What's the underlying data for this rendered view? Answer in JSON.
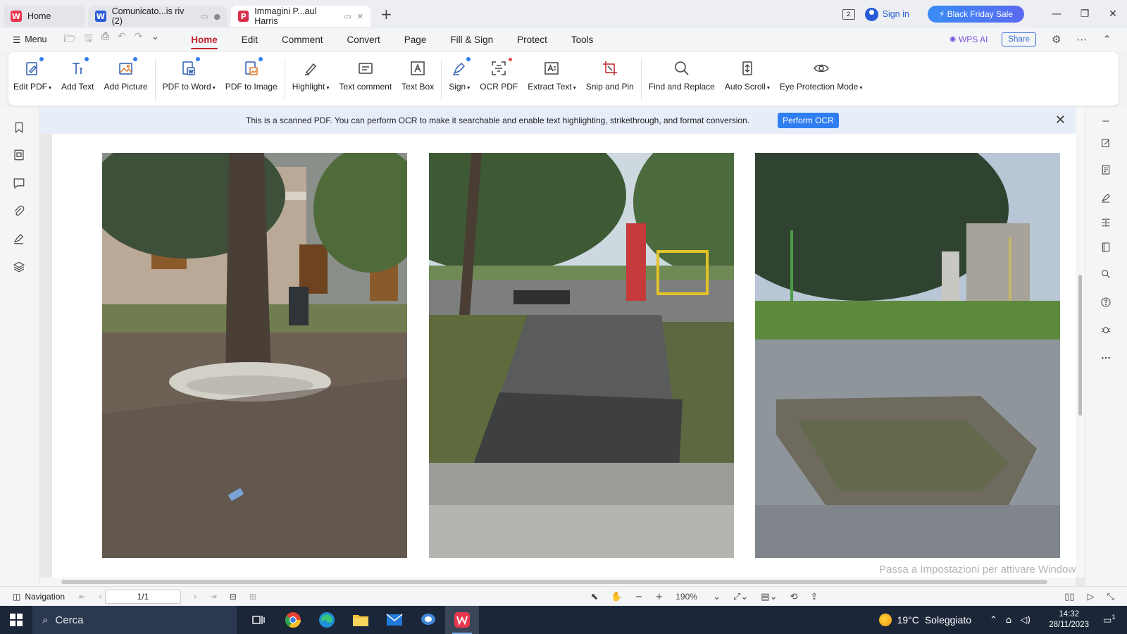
{
  "tabs": [
    {
      "label": "Home",
      "icon": "wps-logo-icon"
    },
    {
      "label": "Comunicato...is riv (2)",
      "icon": "word-doc-icon"
    },
    {
      "label": "Immagini P...aul Harris",
      "icon": "pdf-doc-icon"
    }
  ],
  "titlebar": {
    "page_indicator": "2",
    "sign_in": "Sign in",
    "promo": "Black Friday Sale"
  },
  "menubar": {
    "menu_label": "Menu",
    "tabs": [
      "Home",
      "Edit",
      "Comment",
      "Convert",
      "Page",
      "Fill & Sign",
      "Protect",
      "Tools"
    ],
    "active_tab": "Home",
    "wps_ai": "WPS AI",
    "share": "Share"
  },
  "ribbon": {
    "edit_pdf": "Edit PDF",
    "add_text": "Add Text",
    "add_picture": "Add Picture",
    "pdf_to_word": "PDF to Word",
    "pdf_to_image": "PDF to Image",
    "highlight": "Highlight",
    "text_comment": "Text comment",
    "text_box": "Text Box",
    "sign": "Sign",
    "ocr_pdf": "OCR PDF",
    "extract_text": "Extract Text",
    "snip_and_pin": "Snip and Pin",
    "find_and_replace": "Find and Replace",
    "auto_scroll": "Auto Scroll",
    "eye_protection": "Eye Protection Mode"
  },
  "ocr_banner": {
    "message": "This is a scanned PDF. You can perform OCR to make it searchable and enable text highlighting, strikethrough, and format conversion.",
    "button": "Perform OCR"
  },
  "watermark": "Passa a Impostazioni per attivare Windows.",
  "statusbar": {
    "navigation": "Navigation",
    "page_value": "1/1",
    "zoom": "190%"
  },
  "taskbar": {
    "search_placeholder": "Cerca",
    "weather_temp": "19°C",
    "weather_desc": "Soleggiato",
    "time": "14:32",
    "date": "28/11/2023",
    "notifications": "1"
  },
  "colors": {
    "accent_red": "#c0232b",
    "accent_blue": "#2f7ef0",
    "taskbar": "#1b2638"
  }
}
